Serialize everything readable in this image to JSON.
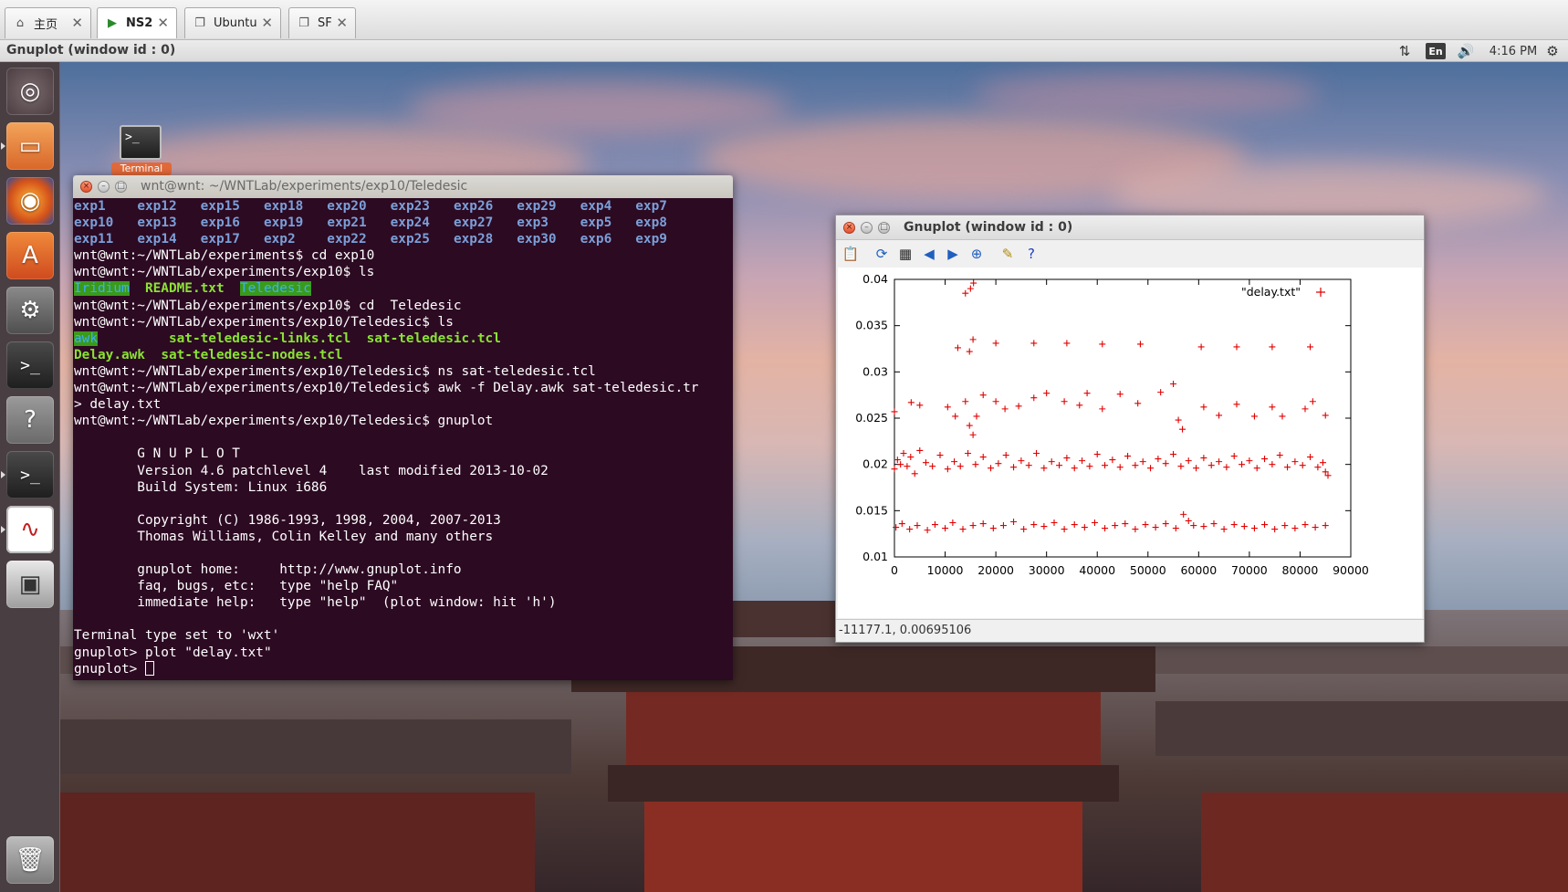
{
  "host_tabs": [
    {
      "label": "主页",
      "icon": "home-icon"
    },
    {
      "label": "NS2",
      "icon": "vm-running-icon"
    },
    {
      "label": "Ubuntu",
      "icon": "vm-icon"
    },
    {
      "label": "SF",
      "icon": "vm-icon"
    }
  ],
  "top_panel": {
    "window_title": "Gnuplot (window id : 0)",
    "input_method": "En",
    "clock": "4:16 PM"
  },
  "desktop": {
    "icon_label": "Terminal"
  },
  "terminal": {
    "title": "wnt@wnt: ~/WNTLab/experiments/exp10/Teledesic",
    "ls_dirs": [
      [
        "exp1",
        "exp12",
        "exp15",
        "exp18",
        "exp20",
        "exp23",
        "exp26",
        "exp29",
        "exp4",
        "exp7"
      ],
      [
        "exp10",
        "exp13",
        "exp16",
        "exp19",
        "exp21",
        "exp24",
        "exp27",
        "exp3",
        "exp5",
        "exp8"
      ],
      [
        "exp11",
        "exp14",
        "exp17",
        "exp2",
        "exp22",
        "exp25",
        "exp28",
        "exp30",
        "exp6",
        "exp9"
      ]
    ],
    "prompt_exp": "wnt@wnt:~/WNTLab/experiments$ ",
    "prompt_exp10": "wnt@wnt:~/WNTLab/experiments/exp10$ ",
    "prompt_teledesic": "wnt@wnt:~/WNTLab/experiments/exp10/Teledesic$ ",
    "cmd_cd_exp10": "cd exp10",
    "cmd_ls": "ls",
    "ls_exp10": [
      "Iridium",
      "README.txt",
      "Teledesic"
    ],
    "cmd_cd_teledesic": "cd  Teledesic",
    "ls_teledesic": [
      "awk",
      "sat-teledesic-links.tcl",
      "sat-teledesic.tcl",
      "Delay.awk",
      "sat-teledesic-nodes.tcl"
    ],
    "cmd_ns": "ns sat-teledesic.tcl",
    "cmd_awk": "awk -f Delay.awk sat-teledesic.tr",
    "continuation": "> delay.txt",
    "cmd_gnuplot": "gnuplot",
    "banner": [
      "        G N U P L O T",
      "        Version 4.6 patchlevel 4    last modified 2013-10-02",
      "        Build System: Linux i686",
      "",
      "        Copyright (C) 1986-1993, 1998, 2004, 2007-2013",
      "        Thomas Williams, Colin Kelley and many others",
      "",
      "        gnuplot home:     http://www.gnuplot.info",
      "        faq, bugs, etc:   type \"help FAQ\"",
      "        immediate help:   type \"help\"  (plot window: hit 'h')"
    ],
    "terminal_type": "Terminal type set to 'wxt'",
    "gnuplot_prompt": "gnuplot> ",
    "plot_cmd": "plot \"delay.txt\""
  },
  "gnuplot": {
    "title": "Gnuplot (window id : 0)",
    "status": "-11177.1, 0.00695106",
    "toolbar": [
      {
        "name": "copy-to-clipboard-icon",
        "glyph": "📋",
        "color": "#8a6a20"
      },
      {
        "name": "replot-icon",
        "glyph": "⟳",
        "color": "#1f5fbf"
      },
      {
        "name": "grid-icon",
        "glyph": "▦",
        "color": "#222222"
      },
      {
        "name": "zoom-prev-icon",
        "glyph": "◀",
        "color": "#1f5fbf"
      },
      {
        "name": "zoom-next-icon",
        "glyph": "▶",
        "color": "#1f5fbf"
      },
      {
        "name": "autoscale-icon",
        "glyph": "⊕",
        "color": "#1f5fbf"
      },
      {
        "name": "settings-icon",
        "glyph": "✎",
        "color": "#b08a10"
      },
      {
        "name": "help-icon",
        "glyph": "?",
        "color": "#1f3fbf"
      }
    ]
  },
  "chart_data": {
    "type": "scatter",
    "title": "",
    "xlabel": "",
    "ylabel": "",
    "xlim": [
      0,
      90000
    ],
    "ylim": [
      0.01,
      0.04
    ],
    "xticks": [
      "0",
      "10000",
      "20000",
      "30000",
      "40000",
      "50000",
      "60000",
      "70000",
      "80000",
      "90000"
    ],
    "yticks": [
      "0.01",
      "0.015",
      "0.02",
      "0.025",
      "0.03",
      "0.035",
      "0.04"
    ],
    "grid": false,
    "legend_position": "top-right",
    "marker": "+",
    "color": "#e00000",
    "series": [
      {
        "name": "\"delay.txt\"",
        "points": [
          [
            0,
            0.0195
          ],
          [
            600,
            0.0205
          ],
          [
            1200,
            0.02
          ],
          [
            1800,
            0.0212
          ],
          [
            2500,
            0.0198
          ],
          [
            3200,
            0.0208
          ],
          [
            4000,
            0.019
          ],
          [
            5000,
            0.0215
          ],
          [
            6200,
            0.0202
          ],
          [
            7500,
            0.0198
          ],
          [
            9000,
            0.021
          ],
          [
            10500,
            0.0195
          ],
          [
            11800,
            0.0203
          ],
          [
            13000,
            0.0198
          ],
          [
            14500,
            0.0212
          ],
          [
            16000,
            0.02
          ],
          [
            17500,
            0.0208
          ],
          [
            19000,
            0.0196
          ],
          [
            20500,
            0.0201
          ],
          [
            22000,
            0.021
          ],
          [
            23500,
            0.0197
          ],
          [
            25000,
            0.0204
          ],
          [
            26500,
            0.0199
          ],
          [
            28000,
            0.0212
          ],
          [
            29500,
            0.0196
          ],
          [
            31000,
            0.0203
          ],
          [
            32500,
            0.0199
          ],
          [
            34000,
            0.0207
          ],
          [
            35500,
            0.0196
          ],
          [
            37000,
            0.0204
          ],
          [
            38500,
            0.0198
          ],
          [
            40000,
            0.0211
          ],
          [
            41500,
            0.0199
          ],
          [
            43000,
            0.0205
          ],
          [
            44500,
            0.0197
          ],
          [
            46000,
            0.0209
          ],
          [
            47500,
            0.0199
          ],
          [
            49000,
            0.0203
          ],
          [
            50500,
            0.0196
          ],
          [
            52000,
            0.0206
          ],
          [
            53500,
            0.0201
          ],
          [
            55000,
            0.0211
          ],
          [
            56500,
            0.0198
          ],
          [
            58000,
            0.0204
          ],
          [
            59500,
            0.0196
          ],
          [
            61000,
            0.0207
          ],
          [
            62500,
            0.0199
          ],
          [
            64000,
            0.0203
          ],
          [
            65500,
            0.0197
          ],
          [
            67000,
            0.0209
          ],
          [
            68500,
            0.02
          ],
          [
            70000,
            0.0204
          ],
          [
            71500,
            0.0196
          ],
          [
            73000,
            0.0206
          ],
          [
            74500,
            0.02
          ],
          [
            76000,
            0.021
          ],
          [
            77500,
            0.0197
          ],
          [
            79000,
            0.0203
          ],
          [
            80500,
            0.0199
          ],
          [
            82000,
            0.0208
          ],
          [
            83500,
            0.0197
          ],
          [
            84500,
            0.0202
          ],
          [
            85000,
            0.0192
          ],
          [
            85500,
            0.0188
          ],
          [
            300,
            0.0132
          ],
          [
            1500,
            0.0136
          ],
          [
            3000,
            0.013
          ],
          [
            4500,
            0.0134
          ],
          [
            6500,
            0.0129
          ],
          [
            8000,
            0.0135
          ],
          [
            10000,
            0.0131
          ],
          [
            11500,
            0.0137
          ],
          [
            13500,
            0.013
          ],
          [
            15500,
            0.0134
          ],
          [
            17500,
            0.0136
          ],
          [
            19500,
            0.0131
          ],
          [
            21500,
            0.0134
          ],
          [
            23500,
            0.0138
          ],
          [
            25500,
            0.013
          ],
          [
            27500,
            0.0135
          ],
          [
            29500,
            0.0133
          ],
          [
            31500,
            0.0137
          ],
          [
            33500,
            0.013
          ],
          [
            35500,
            0.0135
          ],
          [
            37500,
            0.0132
          ],
          [
            39500,
            0.0137
          ],
          [
            41500,
            0.0131
          ],
          [
            43500,
            0.0134
          ],
          [
            45500,
            0.0136
          ],
          [
            47500,
            0.013
          ],
          [
            49500,
            0.0135
          ],
          [
            51500,
            0.0132
          ],
          [
            53500,
            0.0136
          ],
          [
            55500,
            0.0131
          ],
          [
            57000,
            0.0146
          ],
          [
            58000,
            0.0139
          ],
          [
            59000,
            0.0134
          ],
          [
            61000,
            0.0133
          ],
          [
            63000,
            0.0136
          ],
          [
            65000,
            0.013
          ],
          [
            67000,
            0.0135
          ],
          [
            69000,
            0.0133
          ],
          [
            71000,
            0.0131
          ],
          [
            73000,
            0.0135
          ],
          [
            75000,
            0.013
          ],
          [
            77000,
            0.0134
          ],
          [
            79000,
            0.0131
          ],
          [
            81000,
            0.0135
          ],
          [
            83000,
            0.0132
          ],
          [
            85000,
            0.0134
          ],
          [
            0,
            0.0257
          ],
          [
            3300,
            0.0267
          ],
          [
            5000,
            0.0264
          ],
          [
            10500,
            0.0262
          ],
          [
            12000,
            0.0252
          ],
          [
            14000,
            0.0268
          ],
          [
            14800,
            0.0242
          ],
          [
            15500,
            0.0232
          ],
          [
            16200,
            0.0252
          ],
          [
            17500,
            0.0275
          ],
          [
            20000,
            0.0268
          ],
          [
            21800,
            0.026
          ],
          [
            24500,
            0.0263
          ],
          [
            27500,
            0.0272
          ],
          [
            30000,
            0.0277
          ],
          [
            33500,
            0.0268
          ],
          [
            36500,
            0.0264
          ],
          [
            38000,
            0.0277
          ],
          [
            41000,
            0.026
          ],
          [
            44500,
            0.0276
          ],
          [
            48000,
            0.0266
          ],
          [
            52500,
            0.0278
          ],
          [
            55000,
            0.0287
          ],
          [
            56000,
            0.0248
          ],
          [
            56800,
            0.0238
          ],
          [
            61000,
            0.0262
          ],
          [
            64000,
            0.0253
          ],
          [
            67500,
            0.0265
          ],
          [
            71000,
            0.0252
          ],
          [
            74500,
            0.0262
          ],
          [
            76500,
            0.0252
          ],
          [
            81000,
            0.026
          ],
          [
            82500,
            0.0268
          ],
          [
            85000,
            0.0253
          ],
          [
            12500,
            0.0326
          ],
          [
            14800,
            0.0322
          ],
          [
            15500,
            0.0335
          ],
          [
            20000,
            0.0331
          ],
          [
            27500,
            0.0331
          ],
          [
            34000,
            0.0331
          ],
          [
            41000,
            0.033
          ],
          [
            48500,
            0.033
          ],
          [
            60500,
            0.0327
          ],
          [
            67500,
            0.0327
          ],
          [
            74500,
            0.0327
          ],
          [
            82000,
            0.0327
          ],
          [
            14000,
            0.0385
          ],
          [
            15000,
            0.039
          ],
          [
            15600,
            0.0396
          ]
        ]
      }
    ]
  }
}
